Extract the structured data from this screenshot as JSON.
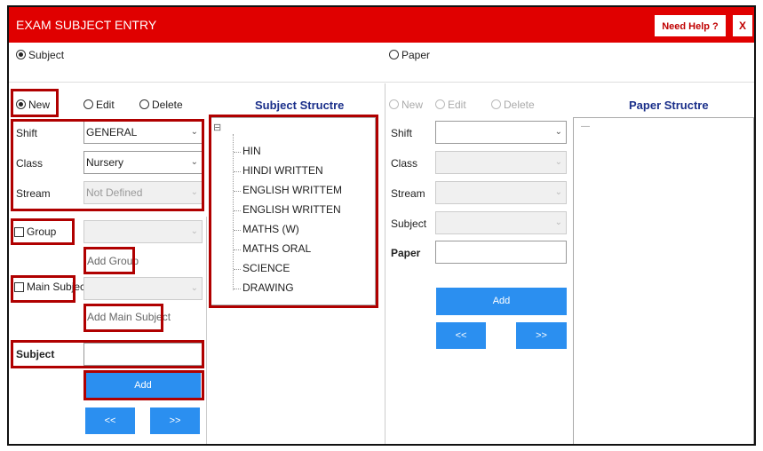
{
  "window": {
    "title": "EXAM SUBJECT ENTRY",
    "help_label": "Need Help ?",
    "close_label": "X"
  },
  "mode": {
    "subject_label": "Subject",
    "paper_label": "Paper",
    "selected": "Subject"
  },
  "left": {
    "actions": {
      "new": "New",
      "edit": "Edit",
      "delete": "Delete",
      "selected": "New"
    },
    "shift": {
      "label": "Shift",
      "value": "GENERAL"
    },
    "class": {
      "label": "Class",
      "value": "Nursery"
    },
    "stream": {
      "label": "Stream",
      "value": "Not Defined"
    },
    "group": {
      "label": "Group",
      "checked": false
    },
    "add_group": "Add Group",
    "main_subject": {
      "label": "Main Subject",
      "checked": false
    },
    "add_main_subject": "Add Main Subject",
    "subject": {
      "label": "Subject",
      "value": ""
    },
    "add_label": "Add",
    "prev_label": "<<",
    "next_label": ">>"
  },
  "subject_structure": {
    "title": "Subject Structre",
    "expander": "⊟",
    "items": [
      "HIN",
      "HINDI WRITTEN",
      "ENGLISH WRITTEM",
      "ENGLISH WRITTEN",
      "MATHS (W)",
      "MATHS ORAL",
      "SCIENCE",
      "DRAWING"
    ]
  },
  "right": {
    "actions": {
      "new": "New",
      "edit": "Edit",
      "delete": "Delete"
    },
    "shift": {
      "label": "Shift",
      "value": ""
    },
    "class": {
      "label": "Class",
      "value": ""
    },
    "stream": {
      "label": "Stream",
      "value": ""
    },
    "subject": {
      "label": "Subject",
      "value": ""
    },
    "paper": {
      "label": "Paper",
      "value": ""
    },
    "add_label": "Add",
    "prev_label": "<<",
    "next_label": ">>"
  },
  "paper_structure": {
    "title": "Paper Structre",
    "placeholder_line": "—"
  },
  "colors": {
    "titlebar": "#e00000",
    "button": "#2b8ff0",
    "highlight": "#b00000"
  }
}
